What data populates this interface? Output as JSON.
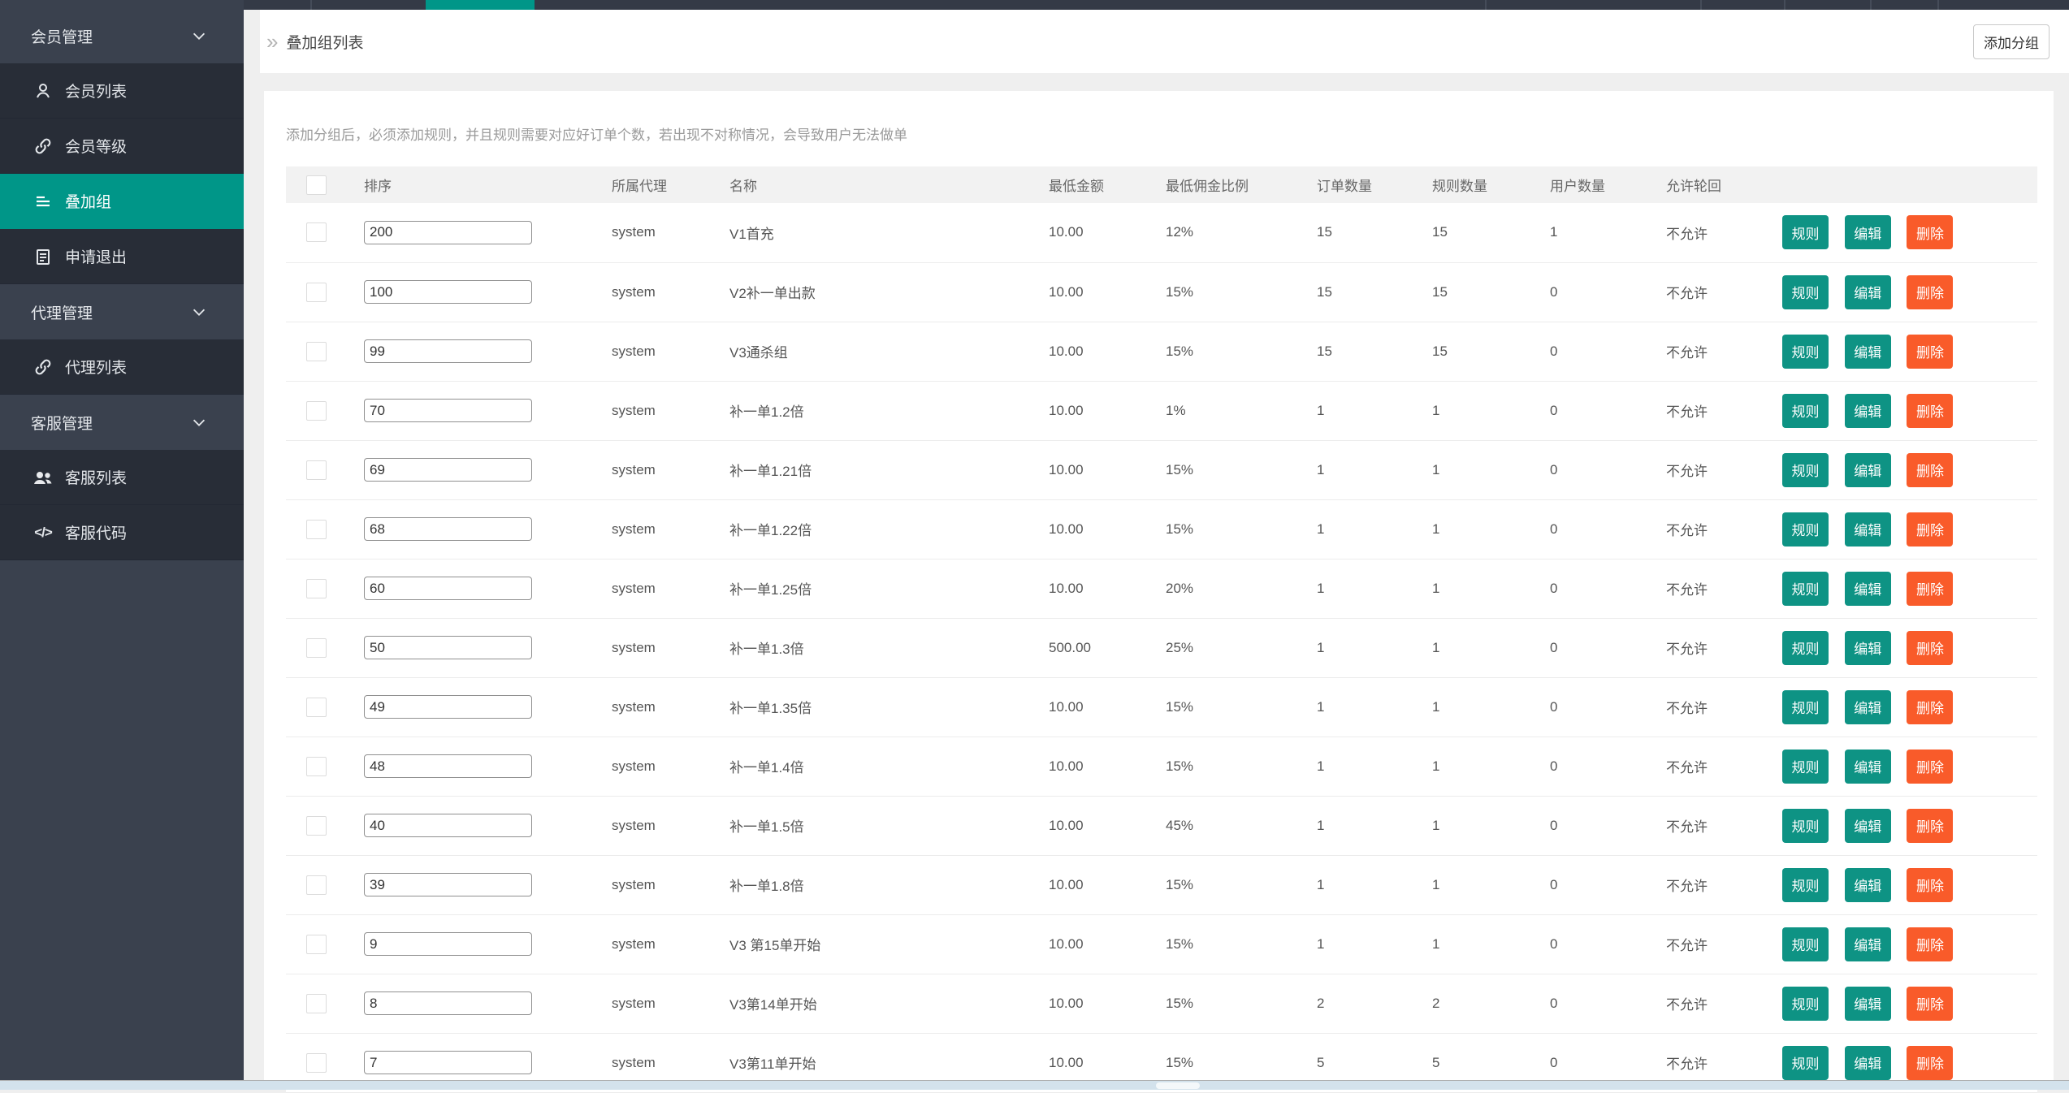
{
  "colors": {
    "accent_teal": "#009688",
    "button_teal": "#0e9384",
    "button_orange": "#f95b2a",
    "sidebar_bg": "#3a414e",
    "sidebar_sub_bg": "#282d37",
    "topbar_bg": "#343a46",
    "page_bg": "#efefef",
    "scrollbar_track": "#d3e2ec"
  },
  "sidebar": {
    "items": [
      {
        "label": "会员管理",
        "type": "group",
        "icon": "chevron-down-icon"
      },
      {
        "label": "会员列表",
        "type": "sub",
        "icon": "user-icon"
      },
      {
        "label": "会员等级",
        "type": "sub",
        "icon": "link-icon"
      },
      {
        "label": "叠加组",
        "type": "sub",
        "icon": "list-icon",
        "active": true
      },
      {
        "label": "申请退出",
        "type": "sub",
        "icon": "clipboard-icon"
      },
      {
        "label": "代理管理",
        "type": "group",
        "icon": "chevron-down-icon"
      },
      {
        "label": "代理列表",
        "type": "sub",
        "icon": "link-icon"
      },
      {
        "label": "客服管理",
        "type": "group",
        "icon": "chevron-down-icon"
      },
      {
        "label": "客服列表",
        "type": "sub",
        "icon": "users-icon"
      },
      {
        "label": "客服代码",
        "type": "sub",
        "icon": "code-icon",
        "icon_glyph": "</>"
      }
    ]
  },
  "header": {
    "breadcrumb": "叠加组列表",
    "breadcrumb_icon": "»",
    "add_button": "添加分组"
  },
  "notice": "添加分组后，必须添加规则，并且规则需要对应好订单个数，若出现不对称情况，会导致用户无法做单",
  "table": {
    "columns": [
      "排序",
      "所属代理",
      "名称",
      "最低金额",
      "最低佣金比例",
      "订单数量",
      "规则数量",
      "用户数量",
      "允许轮回"
    ],
    "actions": {
      "rule": "规则",
      "edit": "编辑",
      "delete": "删除"
    },
    "rows": [
      {
        "sort": "200",
        "agent": "system",
        "name": "V1首充",
        "min_amount": "10.00",
        "commission": "12%",
        "orders": "15",
        "rules": "15",
        "users": "1",
        "cycle": "不允许"
      },
      {
        "sort": "100",
        "agent": "system",
        "name": "V2补一单出款",
        "min_amount": "10.00",
        "commission": "15%",
        "orders": "15",
        "rules": "15",
        "users": "0",
        "cycle": "不允许"
      },
      {
        "sort": "99",
        "agent": "system",
        "name": "V3通杀组",
        "min_amount": "10.00",
        "commission": "15%",
        "orders": "15",
        "rules": "15",
        "users": "0",
        "cycle": "不允许"
      },
      {
        "sort": "70",
        "agent": "system",
        "name": "补一单1.2倍",
        "min_amount": "10.00",
        "commission": "1%",
        "orders": "1",
        "rules": "1",
        "users": "0",
        "cycle": "不允许"
      },
      {
        "sort": "69",
        "agent": "system",
        "name": "补一单1.21倍",
        "min_amount": "10.00",
        "commission": "15%",
        "orders": "1",
        "rules": "1",
        "users": "0",
        "cycle": "不允许"
      },
      {
        "sort": "68",
        "agent": "system",
        "name": "补一单1.22倍",
        "min_amount": "10.00",
        "commission": "15%",
        "orders": "1",
        "rules": "1",
        "users": "0",
        "cycle": "不允许"
      },
      {
        "sort": "60",
        "agent": "system",
        "name": "补一单1.25倍",
        "min_amount": "10.00",
        "commission": "20%",
        "orders": "1",
        "rules": "1",
        "users": "0",
        "cycle": "不允许"
      },
      {
        "sort": "50",
        "agent": "system",
        "name": "补一单1.3倍",
        "min_amount": "500.00",
        "commission": "25%",
        "orders": "1",
        "rules": "1",
        "users": "0",
        "cycle": "不允许"
      },
      {
        "sort": "49",
        "agent": "system",
        "name": "补一单1.35倍",
        "min_amount": "10.00",
        "commission": "15%",
        "orders": "1",
        "rules": "1",
        "users": "0",
        "cycle": "不允许"
      },
      {
        "sort": "48",
        "agent": "system",
        "name": "补一单1.4倍",
        "min_amount": "10.00",
        "commission": "15%",
        "orders": "1",
        "rules": "1",
        "users": "0",
        "cycle": "不允许"
      },
      {
        "sort": "40",
        "agent": "system",
        "name": "补一单1.5倍",
        "min_amount": "10.00",
        "commission": "45%",
        "orders": "1",
        "rules": "1",
        "users": "0",
        "cycle": "不允许"
      },
      {
        "sort": "39",
        "agent": "system",
        "name": "补一单1.8倍",
        "min_amount": "10.00",
        "commission": "15%",
        "orders": "1",
        "rules": "1",
        "users": "0",
        "cycle": "不允许"
      },
      {
        "sort": "9",
        "agent": "system",
        "name": "V3 第15单开始",
        "min_amount": "10.00",
        "commission": "15%",
        "orders": "1",
        "rules": "1",
        "users": "0",
        "cycle": "不允许"
      },
      {
        "sort": "8",
        "agent": "system",
        "name": "V3第14单开始",
        "min_amount": "10.00",
        "commission": "15%",
        "orders": "2",
        "rules": "2",
        "users": "0",
        "cycle": "不允许"
      },
      {
        "sort": "7",
        "agent": "system",
        "name": "V3第11单开始",
        "min_amount": "10.00",
        "commission": "15%",
        "orders": "5",
        "rules": "5",
        "users": "0",
        "cycle": "不允许"
      }
    ]
  }
}
